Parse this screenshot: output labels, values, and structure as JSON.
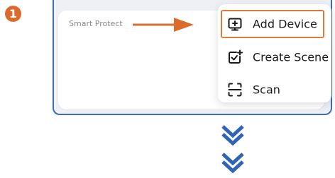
{
  "step": {
    "number": "1"
  },
  "card": {
    "title": "Smart Protect"
  },
  "menu": {
    "items": [
      {
        "label": "Add Device",
        "icon": "add-device-icon",
        "highlighted": true
      },
      {
        "label": "Create Scene",
        "icon": "create-scene-icon",
        "highlighted": false
      },
      {
        "label": "Scan",
        "icon": "scan-icon",
        "highlighted": false
      }
    ]
  },
  "colors": {
    "accent": "#dc6a2b",
    "frame_border": "#3a6fb6",
    "chevron": "#2f64b6"
  }
}
